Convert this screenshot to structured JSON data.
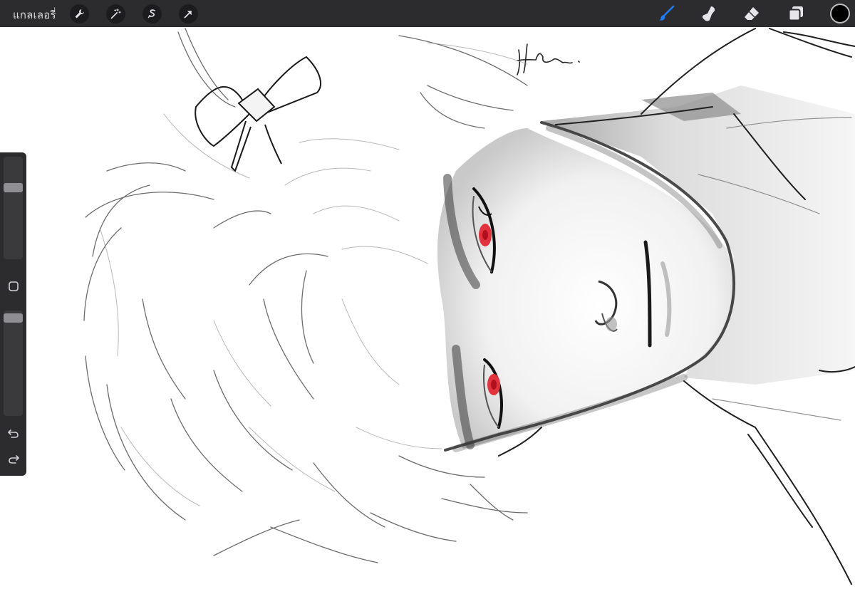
{
  "app": {
    "gallery_label": "แกลเลอรี่"
  },
  "toolbar": {
    "left_tools": [
      {
        "name": "actions",
        "icon": "wrench-icon"
      },
      {
        "name": "adjustments",
        "icon": "magic-wand-icon"
      },
      {
        "name": "selection",
        "icon": "selection-s-icon"
      },
      {
        "name": "transform",
        "icon": "arrow-cursor-icon"
      }
    ],
    "right_tools": [
      {
        "name": "brush",
        "icon": "brush-icon",
        "active": true
      },
      {
        "name": "smudge",
        "icon": "smudge-finger-icon",
        "active": false
      },
      {
        "name": "eraser",
        "icon": "eraser-icon",
        "active": false
      },
      {
        "name": "layers",
        "icon": "layers-icon",
        "active": false
      }
    ],
    "current_color": "#000000",
    "active_color": "#1e7bf2"
  },
  "sidebar": {
    "brush_size_level": 0.72,
    "opacity_level": 0.97,
    "modify_icon": "square-icon",
    "undo_icon": "undo-icon",
    "redo_icon": "redo-icon"
  },
  "canvas": {
    "subject": "sketch-portrait",
    "eye_color": "#e0333e"
  }
}
